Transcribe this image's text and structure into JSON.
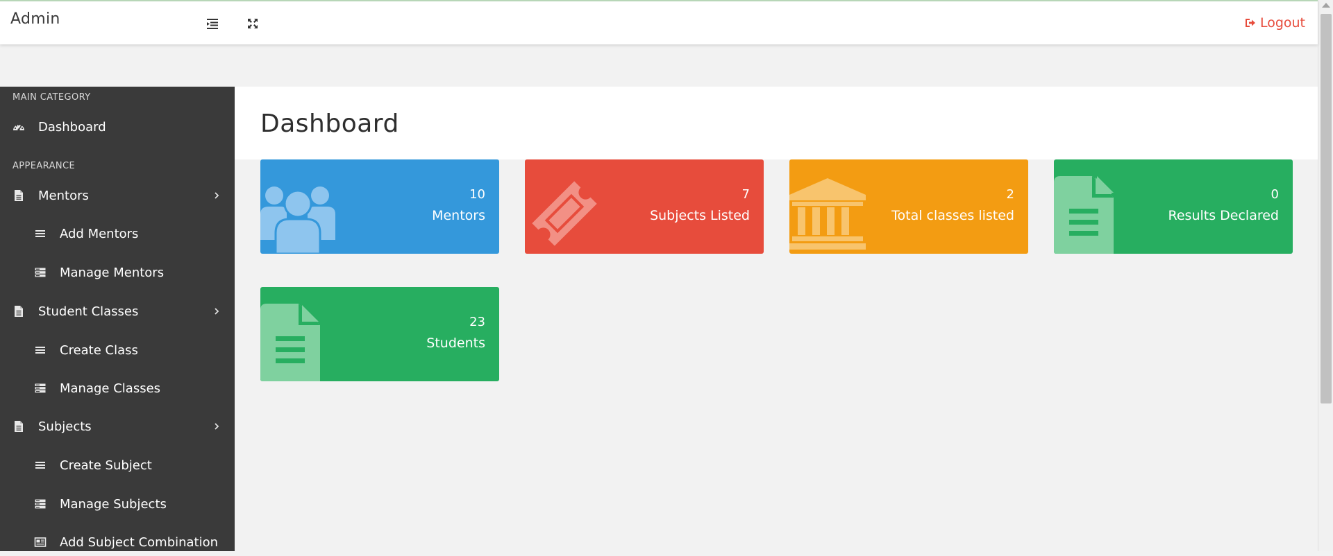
{
  "header": {
    "brand": "Admin",
    "logout_label": "Logout"
  },
  "sidebar": {
    "heading_main": "MAIN CATEGORY",
    "heading_appearance": "APPEARANCE",
    "items": [
      {
        "label": "Dashboard",
        "icon": "dashboard-icon"
      },
      {
        "label": "Mentors",
        "icon": "file-icon"
      },
      {
        "label": "Add Mentors",
        "icon": "list-icon"
      },
      {
        "label": "Manage Mentors",
        "icon": "server-icon"
      },
      {
        "label": "Student Classes",
        "icon": "file-icon"
      },
      {
        "label": "Create Class",
        "icon": "list-icon"
      },
      {
        "label": "Manage Classes",
        "icon": "server-icon"
      },
      {
        "label": "Subjects",
        "icon": "file-icon"
      },
      {
        "label": "Create Subject",
        "icon": "list-icon"
      },
      {
        "label": "Manage Subjects",
        "icon": "server-icon"
      },
      {
        "label": "Add Subject Combination",
        "icon": "newspaper-icon"
      }
    ]
  },
  "main": {
    "page_title": "Dashboard",
    "cards": [
      {
        "count": "10",
        "label": "Mentors",
        "color": "#3498db",
        "icon": "users-icon"
      },
      {
        "count": "7",
        "label": "Subjects Listed",
        "color": "#e74c3c",
        "icon": "ticket-icon"
      },
      {
        "count": "2",
        "label": "Total classes listed",
        "color": "#f39c12",
        "icon": "bank-icon"
      },
      {
        "count": "0",
        "label": "Results Declared",
        "color": "#27ae60",
        "icon": "file-text-icon"
      },
      {
        "count": "23",
        "label": "Students",
        "color": "#27ae60",
        "icon": "file-text-icon"
      }
    ]
  },
  "colors": {
    "sidebar_bg": "#3a3a3a",
    "logout": "#e74c3c",
    "page_bg": "#f2f2f2"
  }
}
